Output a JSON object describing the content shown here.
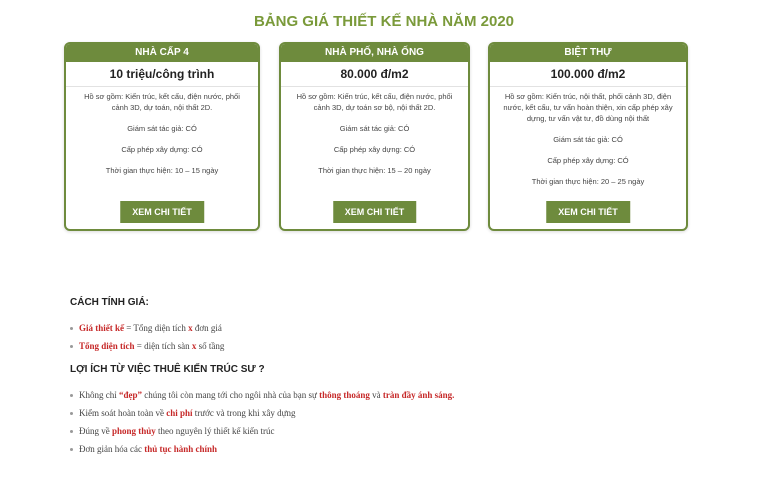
{
  "page_title": "BẢNG GIÁ THIẾT KẾ NHÀ NĂM 2020",
  "cards": [
    {
      "title": "NHÀ CẤP 4",
      "price": "10 triệu/công trình",
      "profile": "Hồ sơ gồm: Kiến trúc, kết cấu, điện nước, phối cảnh 3D, dự toán, nội thất 2D.",
      "supervision": "Giám sát tác giả: CÓ",
      "permit": "Cấp phép xây dựng: CÓ",
      "duration": "Thời gian thực hiện: 10 – 15 ngày",
      "button": "XEM CHI TIẾT"
    },
    {
      "title": "NHÀ PHỐ, NHÀ ỐNG",
      "price": "80.000 đ/m2",
      "profile": "Hồ sơ gồm: Kiến trúc, kết cấu, điện nước, phối cảnh 3D, dự toán sơ bộ, nội thất 2D.",
      "supervision": "Giám sát tác giả: CÓ",
      "permit": "Cấp phép xây dựng: CÓ",
      "duration": "Thời gian thực hiện: 15 – 20 ngày",
      "button": "XEM CHI TIẾT"
    },
    {
      "title": "BIỆT THỰ",
      "price": "100.000 đ/m2",
      "profile": "Hồ sơ gồm: Kiến trúc, nội thất, phối cảnh 3D, điện nước, kết cấu, tư vấn hoàn thiện, xin cấp phép xây dựng, tư vấn vật tư, đồ dùng nội thất",
      "supervision": "Giám sát tác giả: CÓ",
      "permit": "Cấp phép xây dựng: CÓ",
      "duration": "Thời gian thực hiện: 20 – 25 ngày",
      "button": "XEM CHI TIẾT"
    }
  ],
  "pricing": {
    "title": "CÁCH TÍNH GIÁ:",
    "items": [
      {
        "hl1": "Giá thiết kế",
        "t1": " = Tổng diện tích ",
        "hl2": "x",
        "t2": " đơn giá"
      },
      {
        "hl1": "Tổng diện tích",
        "t1": " = diện tích sàn ",
        "hl2": "x",
        "t2": " số tầng"
      }
    ]
  },
  "benefits": {
    "title": "LỢI ÍCH TỪ VIỆC THUÊ KIẾN TRÚC SƯ ?",
    "items": [
      {
        "t1": "Không chỉ ",
        "hl1": "“đẹp”",
        "t2": " chúng tôi còn mang tới cho ngôi nhà của bạn sự ",
        "hl2": "thông thoáng",
        "t3": " và ",
        "hl3": "tràn đầy ánh sáng.",
        "t4": ""
      },
      {
        "t1": "Kiểm soát hoàn toàn về ",
        "hl1": "chi phí",
        "t2": " trước và trong khi xây dựng",
        "hl2": "",
        "t3": "",
        "hl3": "",
        "t4": ""
      },
      {
        "t1": "Đúng về ",
        "hl1": "phong thủy",
        "t2": " theo nguyên lý thiết kế kiến trúc",
        "hl2": "",
        "t3": "",
        "hl3": "",
        "t4": ""
      },
      {
        "t1": "Đơn giản hóa các ",
        "hl1": "thủ tục hành chính",
        "t2": "",
        "hl2": "",
        "t3": "",
        "hl3": "",
        "t4": ""
      }
    ]
  }
}
